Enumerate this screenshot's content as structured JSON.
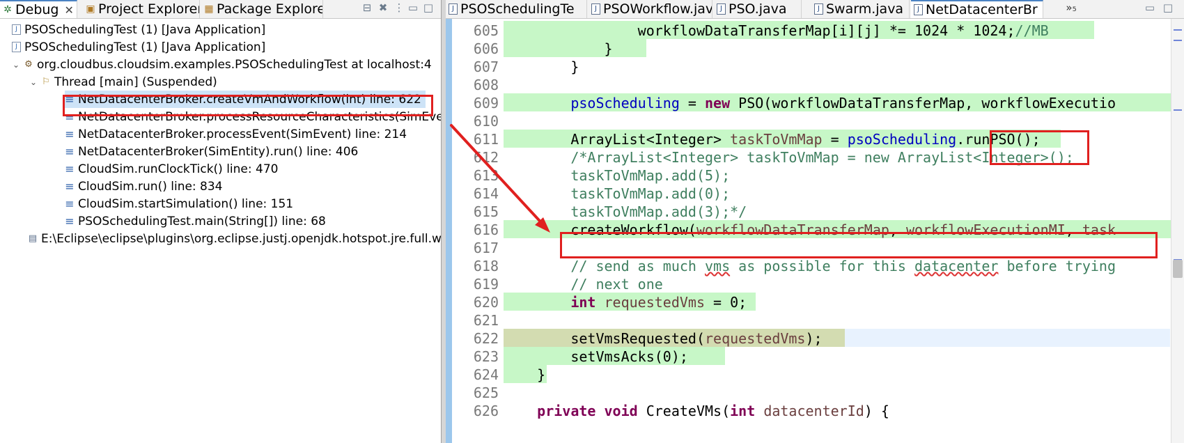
{
  "left_tabs": [
    {
      "label": "Debug",
      "icon": "debug-icon"
    },
    {
      "label": "Project Explorer",
      "icon": "folder-icon"
    },
    {
      "label": "Package Explorer",
      "icon": "package-icon"
    }
  ],
  "right_tabs": [
    {
      "label": "PSOSchedulingTe"
    },
    {
      "label": "PSOWorkflow.jav"
    },
    {
      "label": "PSO.java"
    },
    {
      "label": "Swarm.java"
    },
    {
      "label": "NetDatacenterBr"
    }
  ],
  "overflow_label": "»₅",
  "tree": [
    "PSOSchedulingTest (1) [Java Application]",
    "PSOSchedulingTest (1) [Java Application]",
    "org.cloudbus.cloudsim.examples.PSOSchedulingTest at localhost:4",
    "Thread [main] (Suspended)",
    "NetDatacenterBroker.createVmAndWorkflow(int) line: 622",
    "NetDatacenterBroker.processResourceCharacteristics(SimEve",
    "NetDatacenterBroker.processEvent(SimEvent) line: 214",
    "NetDatacenterBroker(SimEntity).run() line: 406",
    "CloudSim.runClockTick() line: 470",
    "CloudSim.run() line: 834",
    "CloudSim.startSimulation() line: 151",
    "PSOSchedulingTest.main(String[]) line: 68",
    "E:\\Eclipse\\eclipse\\plugins\\org.eclipse.justj.openjdk.hotspot.jre.full.w"
  ],
  "line_numbers": [
    "605",
    "606",
    "607",
    "608",
    "609",
    "610",
    "611",
    "612",
    "613",
    "614",
    "615",
    "616",
    "617",
    "618",
    "619",
    "620",
    "621",
    "622",
    "623",
    "624",
    "625",
    "626"
  ],
  "code": {
    "l605a": "workflowDataTransferMap[i][j] *= 1024 * 1024;",
    "l605b": "//MB",
    "l606": "}",
    "l607": "}",
    "l609a": "psoScheduling",
    "l609b": " = ",
    "l609c": "new",
    "l609d": " PSO(workflowDataTransferMap, workflowExecutio",
    "l611a": "ArrayList<Integer> ",
    "l611b": "taskToVmMap",
    "l611c": " = ",
    "l611d": "psoScheduling",
    "l611e": ".runPSO();",
    "l612": "/*ArrayList<Integer> taskToVmMap = new ArrayList<Integer>();",
    "l613": "taskToVmMap.add(5);",
    "l614": "taskToVmMap.add(0);",
    "l615": "taskToVmMap.add(3);*/",
    "l616a": "createWorkflow(",
    "l616b": "workflowDataTransferMap",
    "l616c": ", ",
    "l616d": "workflowExecutionMI",
    "l616e": ", ",
    "l616f": "task",
    "l618a": "// send as much ",
    "l618b": "vms",
    "l618c": " as possible for this ",
    "l618d": "datacenter",
    "l618e": " before trying",
    "l619": "// next one",
    "l620a": "int",
    "l620b": " ",
    "l620c": "requestedVms",
    "l620d": " = 0;",
    "l622a": "setVmsRequested(",
    "l622b": "requestedVms",
    "l622c": ");",
    "l623": "setVmsAcks(0);",
    "l624": "}",
    "l626a": "private",
    "l626b": " ",
    "l626c": "void",
    "l626d": " CreateVMs(",
    "l626e": "int",
    "l626f": " ",
    "l626g": "datacenterId",
    "l626h": ") {"
  },
  "colors": {
    "highlight_red": "#e0201f",
    "frame_highlight": "#c7f7c7",
    "current_line": "#e8f2fe"
  }
}
